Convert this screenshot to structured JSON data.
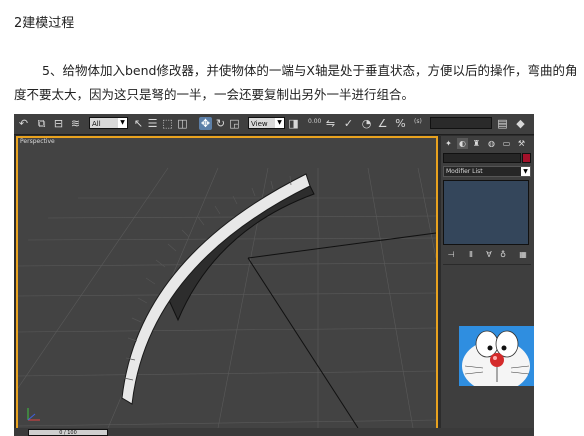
{
  "article": {
    "heading": "2建模过程",
    "paragraph": "5、给物体加入bend修改器，并使物体的一端与X轴是处于垂直状态，方便以后的操作，弯曲的角度不要太大，因为这只是弩的一半，一会还要复制出另外一半进行组合。"
  },
  "toolbar": {
    "selection_filter": "All",
    "ref_coord": "View",
    "spinner_value": "0.00"
  },
  "viewport": {
    "label": "Perspective",
    "border_color": "#e8a21f"
  },
  "command_panel": {
    "modifier_list_label": "Modifier List",
    "object_color": "#a4112a"
  },
  "status_bar": {
    "time_slider": "0 / 100"
  },
  "icons": [
    "undo-icon",
    "link-icon",
    "unlink-icon",
    "bind-space-warp-icon",
    "select-icon",
    "select-by-name-icon",
    "region-select-icon",
    "window-crossing-icon",
    "move-icon",
    "rotate-icon",
    "scale-icon",
    "pivot-icon",
    "mirror-icon",
    "align-icon",
    "snap-icon",
    "angle-snap-icon",
    "percent-snap-icon",
    "spinner-snap-icon",
    "named-selection-icon",
    "layers-icon",
    "curve-editor-icon",
    "render-setup-icon",
    "render-icon",
    "create-tab-icon",
    "modify-tab-icon",
    "hierarchy-tab-icon",
    "motion-tab-icon",
    "display-tab-icon",
    "utilities-tab-icon",
    "pin-stack-icon",
    "show-end-result-icon",
    "make-unique-icon",
    "remove-modifier-icon",
    "configure-modifier-sets-icon",
    "axis-tripod-icon"
  ]
}
